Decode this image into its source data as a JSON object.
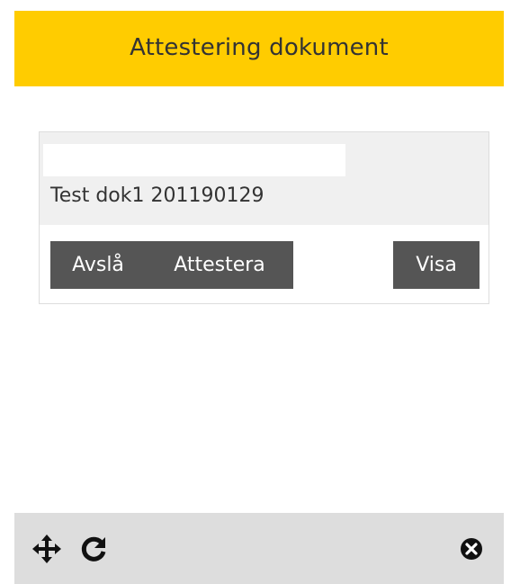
{
  "widget": {
    "title": "Attestering dokument",
    "accent_color": "#ffcc00",
    "documents": [
      {
        "name_field_value": "",
        "title": "Test dok1 201190129",
        "buttons": {
          "reject_label": "Avslå",
          "approve_label": "Attestera",
          "show_label": "Visa"
        }
      }
    ],
    "footer": {
      "icons": [
        "move-icon",
        "refresh-icon",
        "close-icon"
      ]
    }
  }
}
